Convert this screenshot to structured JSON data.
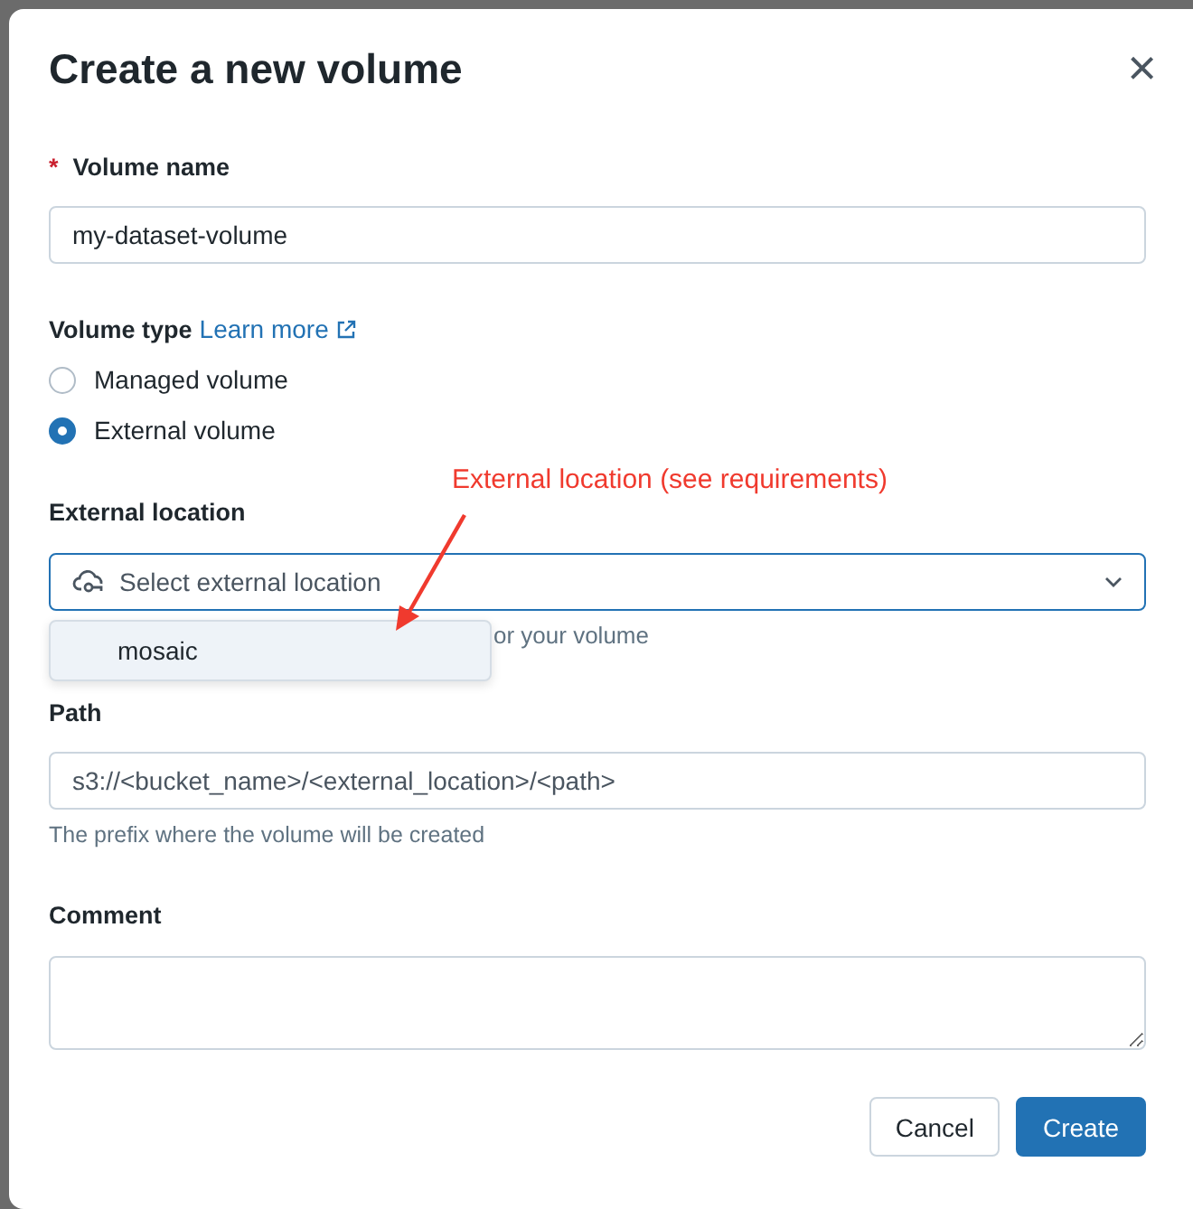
{
  "dialog": {
    "title": "Create a new volume",
    "close": "×"
  },
  "volume_name": {
    "required_mark": "*",
    "label": "Volume name",
    "value": "my-dataset-volume"
  },
  "volume_type": {
    "label": "Volume type",
    "link": "Learn more",
    "options": [
      {
        "label": "Managed volume",
        "selected": false
      },
      {
        "label": "External volume",
        "selected": true
      }
    ]
  },
  "external_location": {
    "label": "External location",
    "placeholder": "Select external location",
    "hint": "or your volume",
    "menu_items": [
      {
        "label": "mosaic"
      }
    ]
  },
  "path": {
    "label": "Path",
    "placeholder": "s3://<bucket_name>/<external_location>/<path>",
    "hint": "The prefix where the volume will be created"
  },
  "comment": {
    "label": "Comment"
  },
  "annotation": {
    "text": "External location (see requirements)"
  },
  "buttons": [
    {
      "label": "Cancel",
      "kind": "secondary"
    },
    {
      "label": "Create",
      "kind": "primary"
    }
  ]
}
